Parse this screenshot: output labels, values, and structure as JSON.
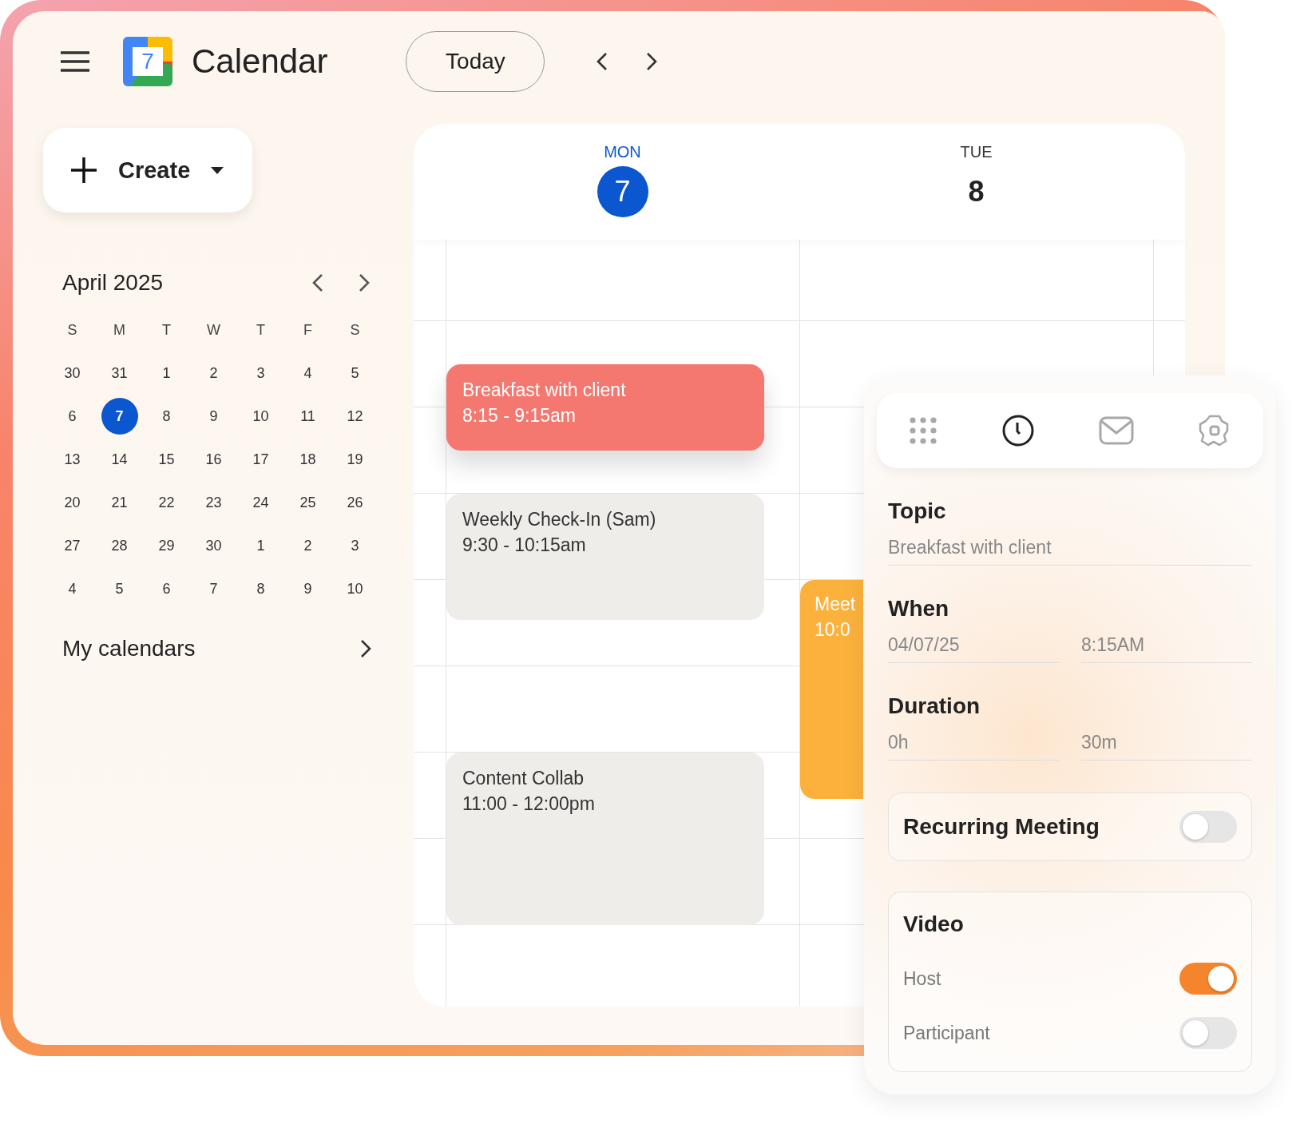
{
  "header": {
    "title": "Calendar",
    "logo_text": "7",
    "today_button": "Today"
  },
  "create_button": "Create",
  "mini_calendar": {
    "title": "April 2025",
    "weekdays": [
      "S",
      "M",
      "T",
      "W",
      "T",
      "F",
      "S"
    ],
    "days": [
      {
        "label": "30",
        "selected": false
      },
      {
        "label": "31",
        "selected": false
      },
      {
        "label": "1",
        "selected": false
      },
      {
        "label": "2",
        "selected": false
      },
      {
        "label": "3",
        "selected": false
      },
      {
        "label": "4",
        "selected": false
      },
      {
        "label": "5",
        "selected": false
      },
      {
        "label": "6",
        "selected": false
      },
      {
        "label": "7",
        "selected": true
      },
      {
        "label": "8",
        "selected": false
      },
      {
        "label": "9",
        "selected": false
      },
      {
        "label": "10",
        "selected": false
      },
      {
        "label": "11",
        "selected": false
      },
      {
        "label": "12",
        "selected": false
      },
      {
        "label": "13",
        "selected": false
      },
      {
        "label": "14",
        "selected": false
      },
      {
        "label": "15",
        "selected": false
      },
      {
        "label": "16",
        "selected": false
      },
      {
        "label": "17",
        "selected": false
      },
      {
        "label": "18",
        "selected": false
      },
      {
        "label": "19",
        "selected": false
      },
      {
        "label": "20",
        "selected": false
      },
      {
        "label": "21",
        "selected": false
      },
      {
        "label": "22",
        "selected": false
      },
      {
        "label": "23",
        "selected": false
      },
      {
        "label": "24",
        "selected": false
      },
      {
        "label": "25",
        "selected": false
      },
      {
        "label": "26",
        "selected": false
      },
      {
        "label": "27",
        "selected": false
      },
      {
        "label": "28",
        "selected": false
      },
      {
        "label": "29",
        "selected": false
      },
      {
        "label": "30",
        "selected": false
      },
      {
        "label": "1",
        "selected": false
      },
      {
        "label": "2",
        "selected": false
      },
      {
        "label": "3",
        "selected": false
      },
      {
        "label": "4",
        "selected": false
      },
      {
        "label": "5",
        "selected": false
      },
      {
        "label": "6",
        "selected": false
      },
      {
        "label": "7",
        "selected": false
      },
      {
        "label": "8",
        "selected": false
      },
      {
        "label": "9",
        "selected": false
      },
      {
        "label": "10",
        "selected": false
      }
    ]
  },
  "my_calendars": "My calendars",
  "day_view": {
    "days": [
      {
        "weekday": "MON",
        "date": "7",
        "selected": true,
        "events": [
          {
            "title": "Breakfast with client",
            "time": "8:15 - 9:15am",
            "kind": "highlight"
          },
          {
            "title": "Weekly Check-In (Sam)",
            "time": "9:30 - 10:15am",
            "kind": "muted"
          },
          {
            "title": "Content Collab",
            "time": "11:00 - 12:00pm",
            "kind": "muted"
          }
        ]
      },
      {
        "weekday": "TUE",
        "date": "8",
        "selected": false,
        "events": [
          {
            "title": "Meet",
            "time": "10:0",
            "kind": "accent"
          }
        ]
      }
    ]
  },
  "event_panel": {
    "tabs": [
      {
        "selected": false
      },
      {
        "selected": true
      },
      {
        "selected": false
      },
      {
        "selected": false
      }
    ],
    "topic": {
      "label": "Topic",
      "value": "Breakfast with client"
    },
    "when": {
      "label": "When",
      "date": "04/07/25",
      "time": "8:15AM"
    },
    "duration": {
      "label": "Duration",
      "hours": "0h",
      "minutes": "30m"
    },
    "recurring": {
      "label": "Recurring Meeting",
      "on": false
    },
    "video": {
      "title": "Video",
      "options": [
        {
          "label": "Host",
          "on": true
        },
        {
          "label": "Participant",
          "on": false
        }
      ]
    }
  }
}
